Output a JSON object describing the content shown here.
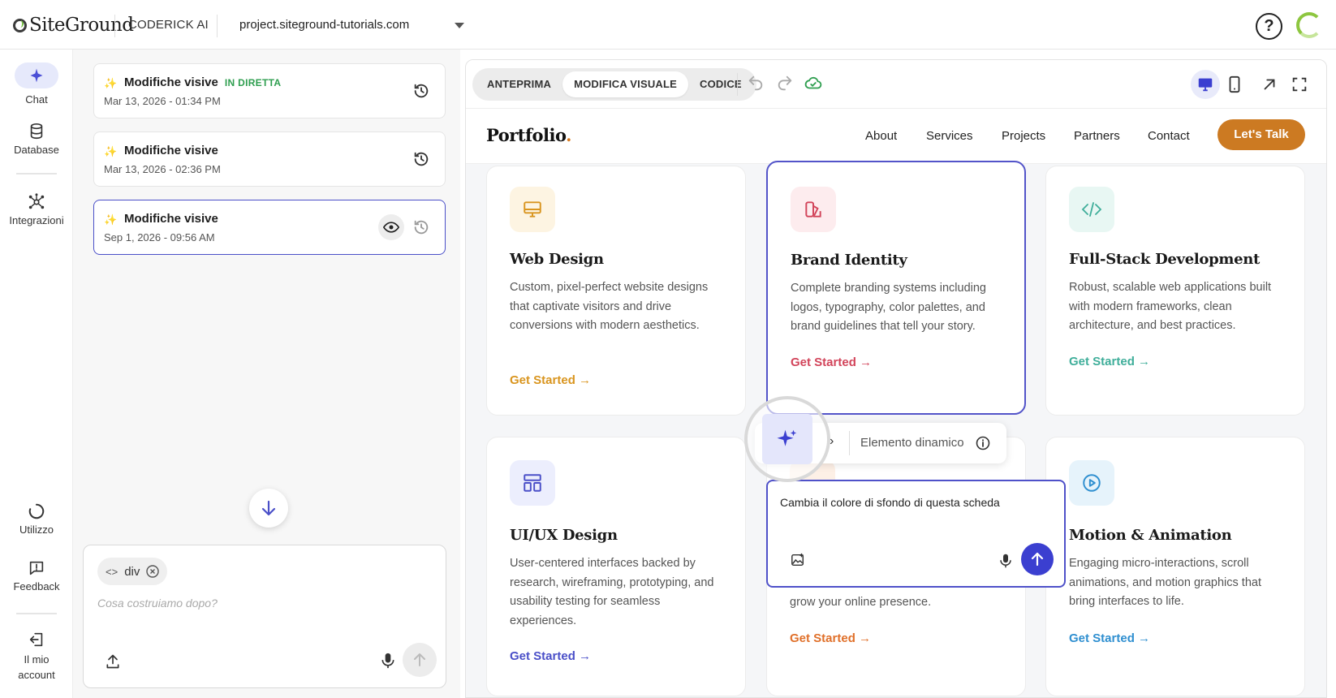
{
  "topbar": {
    "logo_text": "SiteGround",
    "product": "CODERICK AI",
    "domain": "project.siteground-tutorials.com",
    "help_label": "?"
  },
  "rail": {
    "items": [
      {
        "label": "Chat",
        "icon": "sparkle-icon"
      },
      {
        "label": "Database",
        "icon": "database-icon"
      },
      {
        "label": "Integrazioni",
        "icon": "integrations-icon"
      },
      {
        "label": "Utilizzo",
        "icon": "usage-icon"
      },
      {
        "label": "Feedback",
        "icon": "feedback-icon"
      },
      {
        "label": "Il mio account",
        "icon": "logout-icon"
      }
    ]
  },
  "history": {
    "items": [
      {
        "title": "Modifiche visive",
        "badge": "IN DIRETTA",
        "date": "Mar 13, 2026 - 01:34 PM"
      },
      {
        "title": "Modifiche visive",
        "badge": "",
        "date": "Mar 13, 2026 - 02:36 PM"
      },
      {
        "title": "Modifiche visive",
        "badge": "",
        "date": "Sep 1, 2026 - 09:56 AM"
      }
    ]
  },
  "composer": {
    "chip_label": "div",
    "placeholder": "Cosa costruiamo dopo?"
  },
  "preview": {
    "tabs": [
      "ANTEPRIMA",
      "MODIFICA VISUALE",
      "CODICE"
    ],
    "active_tab": "MODIFICA VISUALE",
    "site": {
      "brand": "Portfolio",
      "brand_dot": ".",
      "nav": [
        "About",
        "Services",
        "Projects",
        "Partners",
        "Contact"
      ],
      "cta": "Let's Talk"
    },
    "cards": [
      {
        "title": "Web Design",
        "desc": "Custom, pixel-perfect website designs that captivate visitors and drive conversions with modern aesthetics.",
        "cta": "Get Started →",
        "accent": "#d9951f",
        "tint": "#fdf4e2"
      },
      {
        "title": "Brand Identity",
        "desc": "Complete branding systems including logos, typography, color palettes, and brand guidelines that tell your story.",
        "cta": "Get Started →",
        "accent": "#d2445a",
        "tint": "#fdecee"
      },
      {
        "title": "Full-Stack Development",
        "desc": "Robust, scalable web applications built with modern frameworks, clean architecture, and best practices.",
        "cta": "Get Started →",
        "accent": "#3fae9a",
        "tint": "#e8f7f3"
      },
      {
        "title": "UI/UX Design",
        "desc": "User-centered interfaces backed by research, wireframing, prototyping, and usability testing for seamless experiences.",
        "cta": "Get Started →",
        "accent": "#4a4fc8",
        "tint": "#eceefd"
      },
      {
        "title": "",
        "desc": "grow your online presence.",
        "cta": "Get Started →",
        "accent": "#e0702a",
        "tint": "#fdf0e6"
      },
      {
        "title": "Motion & Animation",
        "desc": "Engaging micro-interactions, scroll animations, and motion graphics that bring interfaces to life.",
        "cta": "Get Started →",
        "accent": "#2f8fd0",
        "tint": "#e6f3fb"
      }
    ],
    "element_bar_label": "Elemento dinamico",
    "prompt_text": "Cambia il colore di sfondo di questa scheda"
  }
}
